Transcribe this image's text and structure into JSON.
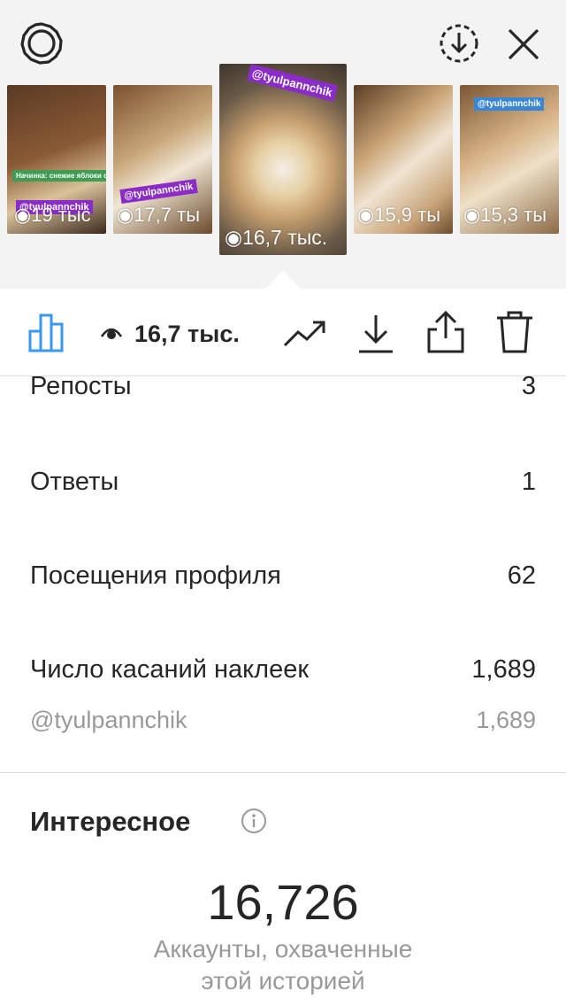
{
  "header": {
    "settings_icon": "gear-icon",
    "download_icon": "download-circle-icon",
    "close_icon": "close-icon"
  },
  "stories": [
    {
      "tag": "@tyulpannchik",
      "views": "19 тыс",
      "caption": "Начинка: снежие яблоки с сахаром"
    },
    {
      "tag": "@tyulpannchik",
      "views": "17,7 ты"
    },
    {
      "tag": "@tyulpannchik",
      "views": "16,7 тыс."
    },
    {
      "views": "15,9 ты"
    },
    {
      "tag": "@tyulpannchik",
      "views": "15,3 ты"
    }
  ],
  "toolbar": {
    "views": "16,7 тыс."
  },
  "stats": {
    "reposts_label": "Репосты",
    "reposts_value": "3",
    "replies_label": "Ответы",
    "replies_value": "1",
    "profile_visits_label": "Посещения профиля",
    "profile_visits_value": "62",
    "sticker_taps_label": "Число касаний наклеек",
    "sticker_taps_value": "1,689",
    "sticker_handle": "@tyulpannchik",
    "sticker_handle_value": "1,689"
  },
  "discovery": {
    "title": "Интересное",
    "reach_value": "16,726",
    "reach_caption_line1": "Аккаунты, охваченные",
    "reach_caption_line2": "этой историей"
  },
  "colors": {
    "accent": "#3897f0",
    "tag_purple": "#8b2cc8",
    "tag_blue": "#3a86d6",
    "muted": "#999999"
  }
}
